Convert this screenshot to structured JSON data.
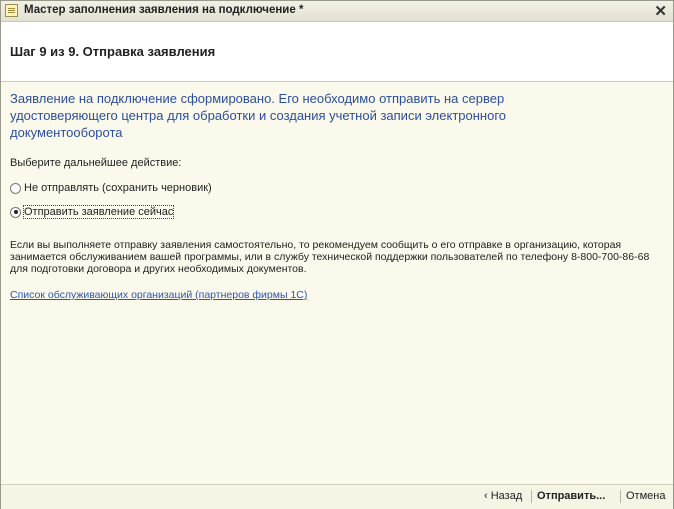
{
  "window": {
    "title": "Мастер заполнения заявления на подключение *",
    "close_glyph": "✕"
  },
  "header": {
    "step_title": "Шаг 9 из 9. Отправка заявления"
  },
  "main": {
    "info_text": "Заявление на подключение сформировано. Его необходимо отправить на сервер удостоверяющего центра для обработки и создания учетной записи электронного документооборота",
    "choose_label": "Выберите дальнейшее действие:",
    "options": [
      {
        "label": "Не отправлять (сохранить черновик)",
        "selected": false
      },
      {
        "label": "Отправить заявление сейчас",
        "selected": true
      }
    ],
    "help_text": "Если вы выполняете отправку заявления самостоятельно, то рекомендуем сообщить о его отправке в организацию, которая занимается обслуживанием вашей программы, или в службу технической поддержки пользователей по телефону 8-800-700-86-68 для подготовки договора и других необходимых документов.",
    "partners_link": "Список обслуживающих организаций (партнеров фирмы 1С)"
  },
  "footer": {
    "back_label": "‹ Назад",
    "send_label": "Отправить...",
    "cancel_label": "Отмена"
  },
  "colors": {
    "info_text": "#2b4f9a",
    "link": "#2d55b0",
    "background": "#fbf9ec"
  },
  "icons": {
    "app": "document-icon",
    "close": "close-icon"
  }
}
